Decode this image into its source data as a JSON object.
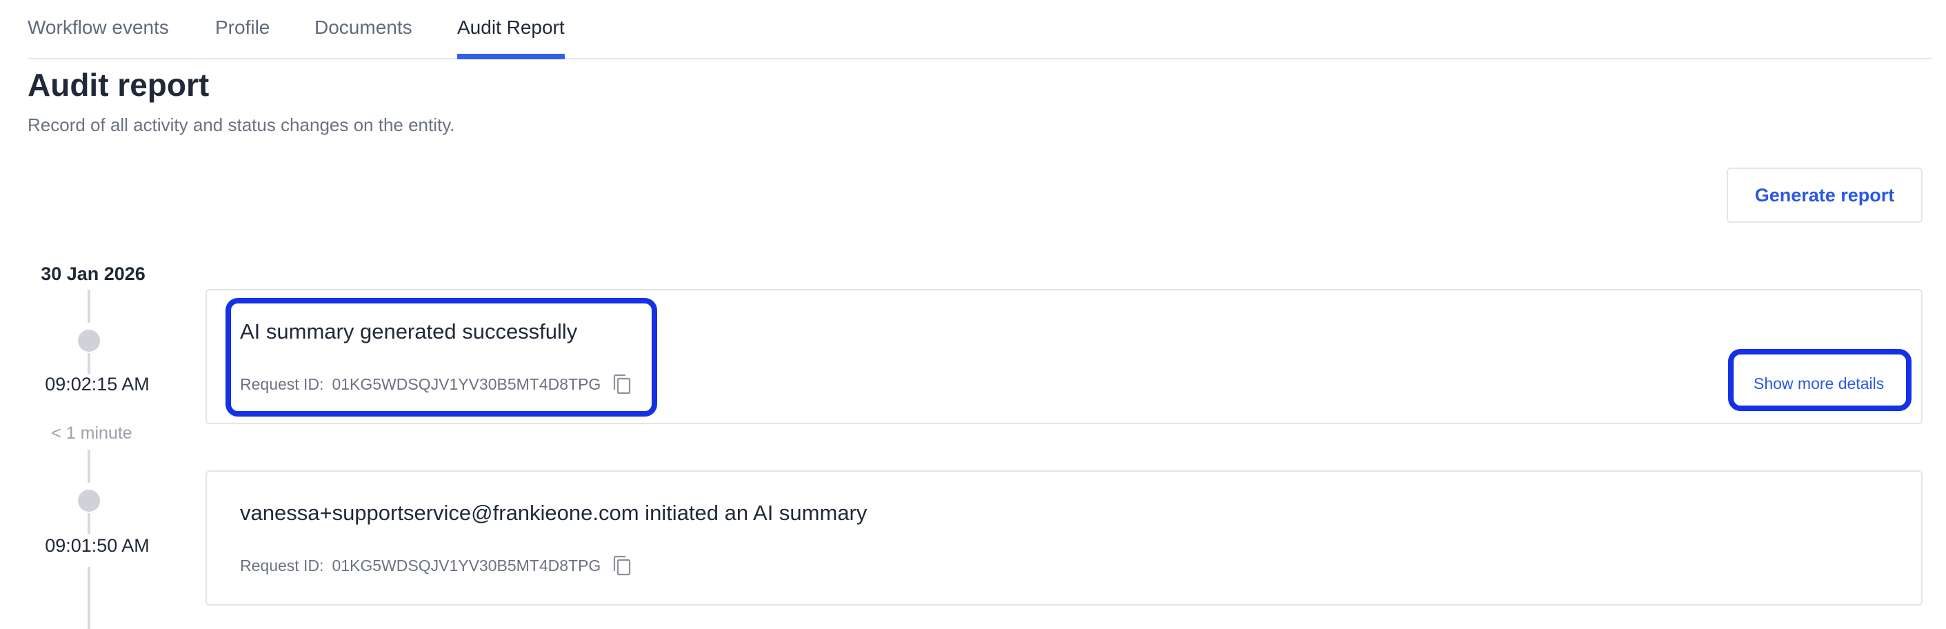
{
  "tabs": [
    {
      "label": "Workflow events",
      "active": false
    },
    {
      "label": "Profile",
      "active": false
    },
    {
      "label": "Documents",
      "active": false
    },
    {
      "label": "Audit Report",
      "active": true
    }
  ],
  "header": {
    "title": "Audit report",
    "subtitle": "Record of all activity and status changes on the entity."
  },
  "actions": {
    "generate_label": "Generate report"
  },
  "timeline": {
    "date": "30 Jan 2026",
    "events": [
      {
        "time": "09:02:15 AM",
        "title": "AI summary generated successfully",
        "request_label": "Request ID:",
        "request_id": "01KG5WDSQJV1YV30B5MT4D8TPG",
        "details_label": "Show more details"
      },
      {
        "time": "09:01:50 AM",
        "title": "vanessa+supportservice@frankieone.com initiated an AI summary",
        "request_label": "Request ID:",
        "request_id": "01KG5WDSQJV1YV30B5MT4D8TPG"
      }
    ],
    "gaps": [
      "< 1 minute"
    ]
  },
  "icons": {
    "copy": "copy-icon"
  },
  "colors": {
    "accent": "#3160e8",
    "highlight": "#1531e6",
    "link": "#2a57e6"
  }
}
